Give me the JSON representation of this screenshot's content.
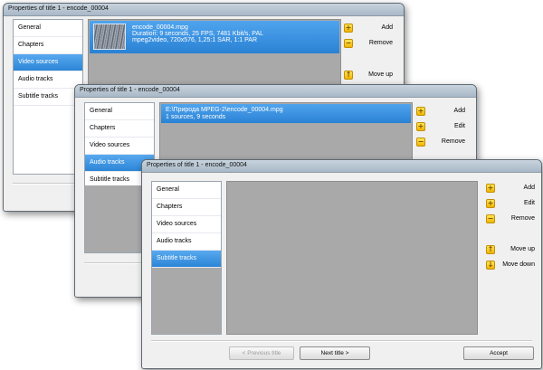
{
  "windows": [
    {
      "title": "Properties of title 1 - encode_00004",
      "nav": [
        "General",
        "Chapters",
        "Video sources",
        "Audio tracks",
        "Subtitle tracks"
      ],
      "selected_nav": "Video sources",
      "file": {
        "name": "encode_00004.mpg",
        "line1": "Duration: 9 seconds, 25 FPS, 7481 Kbit/s, PAL",
        "line2": "mpeg2video, 720x576, 1,25:1 SAR, 1:1 PAR"
      },
      "actions": {
        "add": "Add",
        "remove": "Remove",
        "move_up": "Move up"
      }
    },
    {
      "title": "Properties of title 1 - encode_00004",
      "nav": [
        "General",
        "Chapters",
        "Video sources",
        "Audio tracks",
        "Subtitle tracks"
      ],
      "selected_nav": "Audio tracks",
      "file": {
        "path": "E:\\Природа MPEG-2\\encode_00004.mpg",
        "line1": "1 sources, 9 seconds"
      },
      "actions": {
        "add": "Add",
        "edit": "Edit",
        "remove": "Remove"
      }
    },
    {
      "title": "Properties of title 1 - encode_00004",
      "nav": [
        "General",
        "Chapters",
        "Video sources",
        "Audio tracks",
        "Subtitle tracks"
      ],
      "selected_nav": "Subtitle tracks",
      "actions": {
        "add": "Add",
        "edit": "Edit",
        "remove": "Remove",
        "move_up": "Move up",
        "move_down": "Move down"
      },
      "buttons": {
        "previous": "< Previous title",
        "next": "Next title >",
        "accept": "Accept"
      }
    }
  ],
  "icons": {
    "add": "plus-icon",
    "remove": "minus-icon",
    "move_up": "arrow-up-icon",
    "move_down": "arrow-down-icon"
  },
  "colors": {
    "selection": "#2c85d6",
    "action_icon": "#f0b400",
    "pane": "#a9a9a9"
  }
}
